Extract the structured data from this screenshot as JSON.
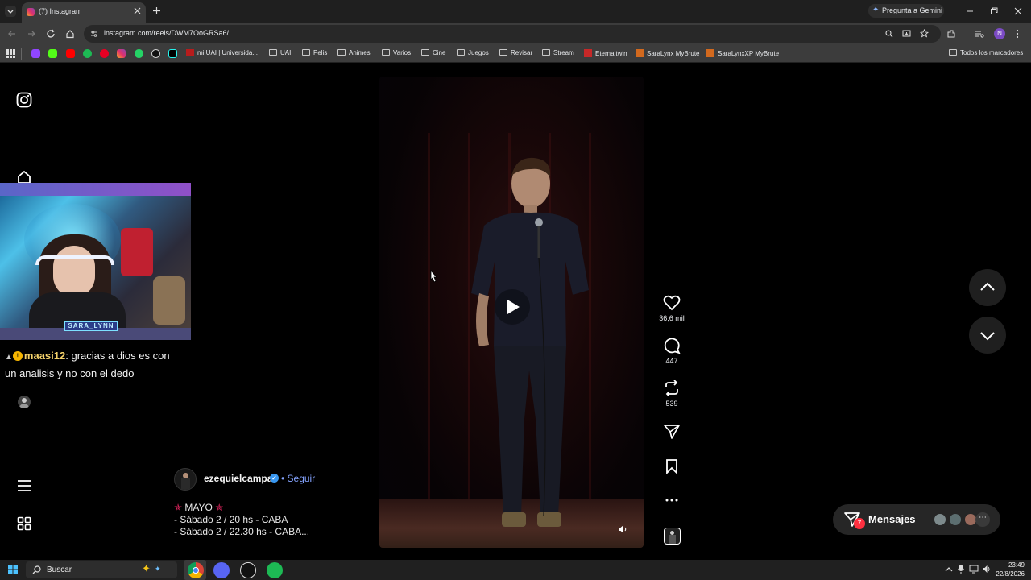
{
  "browser": {
    "tab_title": "(7) Instagram",
    "url": "instagram.com/reels/DWM7OoGRSa6/",
    "gemini_label": "Pregunta a Gemini",
    "bookmarks": [
      "mi UAI | Universida...",
      "UAI",
      "Pelis",
      "Animes",
      "Varios",
      "Cine",
      "Juegos",
      "Revisar",
      "Stream",
      "Eternaltwin",
      "SaraLynx MyBrute",
      "SaraLynxXP MyBrute"
    ],
    "all_bookmarks_label": "Todos los marcadores"
  },
  "reel": {
    "likes": "36,6 mil",
    "comments": "447",
    "reposts": "539",
    "username": "ezequielcampa",
    "follow_label": "• Seguir",
    "caption_lines": [
      "MAYO",
      "- Sábado 2 / 20 hs - CABA",
      "- Sábado 2 / 22.30 hs - CABA..."
    ]
  },
  "messages": {
    "label": "Mensajes",
    "badge": "7"
  },
  "stream_overlay": {
    "streamer_name": "SARA_LYNN",
    "chat_user": "maasi12",
    "chat_line1": ": gracias a dios es con",
    "chat_line2": "un analisis y no con el dedo"
  },
  "taskbar": {
    "search_placeholder": "Buscar",
    "time": "23:49",
    "date": "22/8/2026"
  },
  "colors": {
    "instagram_link": "#85a4ff",
    "notification_red": "#ff3040",
    "browser_frame": "#3c3c3c"
  }
}
